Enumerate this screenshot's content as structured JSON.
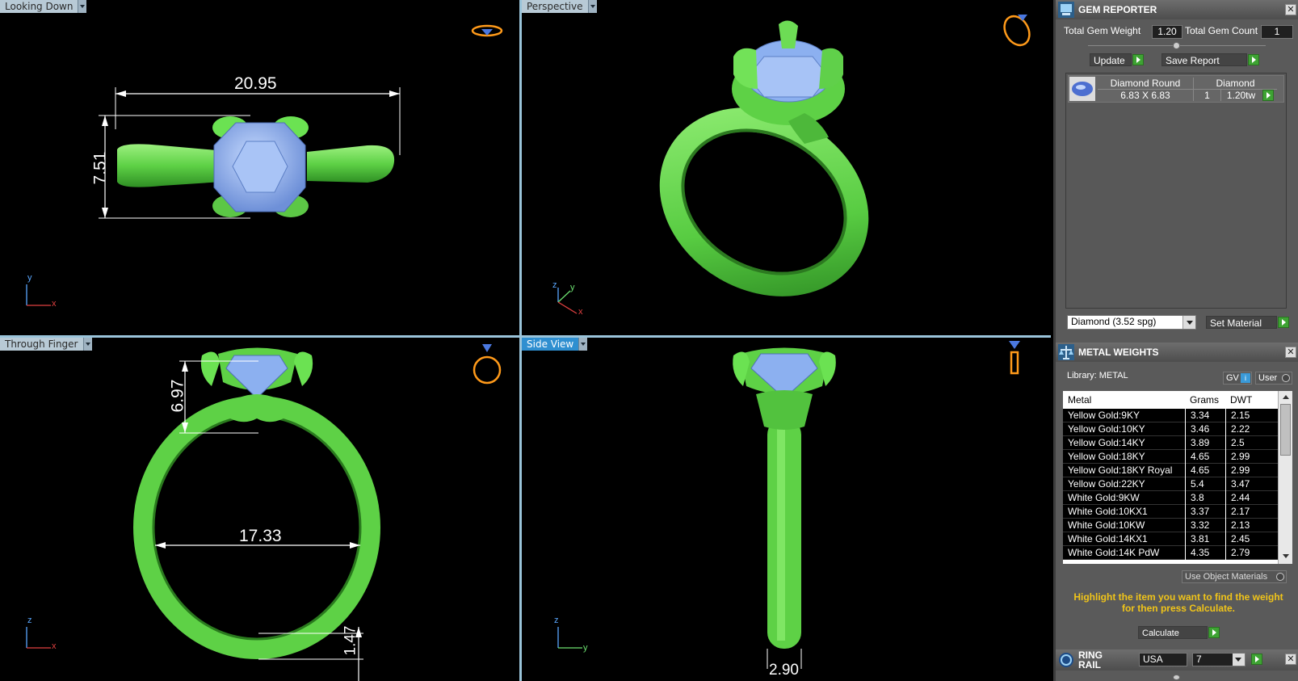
{
  "viewports": {
    "top_left": {
      "label": "Looking Down",
      "dim_width": "20.95",
      "dim_height": "7.51",
      "axis_a": "y",
      "axis_b": "x"
    },
    "top_right": {
      "label": "Perspective",
      "axis_a": "z",
      "axis_b": "y",
      "axis_c": "x"
    },
    "bottom_left": {
      "label": "Through Finger",
      "dim_head": "6.97",
      "dim_inner": "17.33",
      "dim_shank": "1.47",
      "axis_a": "z",
      "axis_b": "x"
    },
    "bottom_right": {
      "label": "Side View",
      "dim_width": "2.90",
      "axis_a": "z",
      "axis_b": "y"
    }
  },
  "gem_reporter": {
    "title": "GEM REPORTER",
    "total_weight_label": "Total Gem Weight",
    "total_weight_value": "1.20",
    "total_count_label": "Total Gem Count",
    "total_count_value": "1",
    "update_label": "Update",
    "save_report_label": "Save Report",
    "gem": {
      "name": "Diamond Round",
      "size": "6.83 X 6.83",
      "material": "Diamond",
      "count": "1",
      "weight": "1.20tw"
    },
    "material_select": "Diamond    (3.52 spg)",
    "set_material_label": "Set Material"
  },
  "metal_weights": {
    "title": "METAL WEIGHTS",
    "library_label": "Library: METAL",
    "gv_label": "GV",
    "user_label": "User",
    "columns": [
      "Metal",
      "Grams",
      "DWT"
    ],
    "rows": [
      {
        "metal": "Yellow Gold:9KY",
        "grams": "3.34",
        "dwt": "2.15"
      },
      {
        "metal": "Yellow Gold:10KY",
        "grams": "3.46",
        "dwt": "2.22"
      },
      {
        "metal": "Yellow Gold:14KY",
        "grams": "3.89",
        "dwt": "2.5"
      },
      {
        "metal": "Yellow Gold:18KY",
        "grams": "4.65",
        "dwt": "2.99"
      },
      {
        "metal": "Yellow Gold:18KY Royal",
        "grams": "4.65",
        "dwt": "2.99"
      },
      {
        "metal": "Yellow Gold:22KY",
        "grams": "5.4",
        "dwt": "3.47"
      },
      {
        "metal": "White Gold:9KW",
        "grams": "3.8",
        "dwt": "2.44"
      },
      {
        "metal": "White Gold:10KX1",
        "grams": "3.37",
        "dwt": "2.17"
      },
      {
        "metal": "White Gold:10KW",
        "grams": "3.32",
        "dwt": "2.13"
      },
      {
        "metal": "White Gold:14KX1",
        "grams": "3.81",
        "dwt": "2.45"
      },
      {
        "metal": "White Gold:14K PdW",
        "grams": "4.35",
        "dwt": "2.79"
      }
    ],
    "use_object_materials_label": "Use Object Materials",
    "hint": "Highlight the item you want to find the weight for then press Calculate.",
    "calculate_label": "Calculate"
  },
  "ring_rail": {
    "title": "RING RAIL",
    "region": "USA",
    "size": "7"
  },
  "colors": {
    "ring_green": "#5fd64a",
    "gem_blue": "#8cb0f0",
    "panel_bg": "#5a5a5a",
    "viewport_bg": "#000000",
    "hint_yellow": "#f0c419",
    "go_green": "#3ea333"
  }
}
